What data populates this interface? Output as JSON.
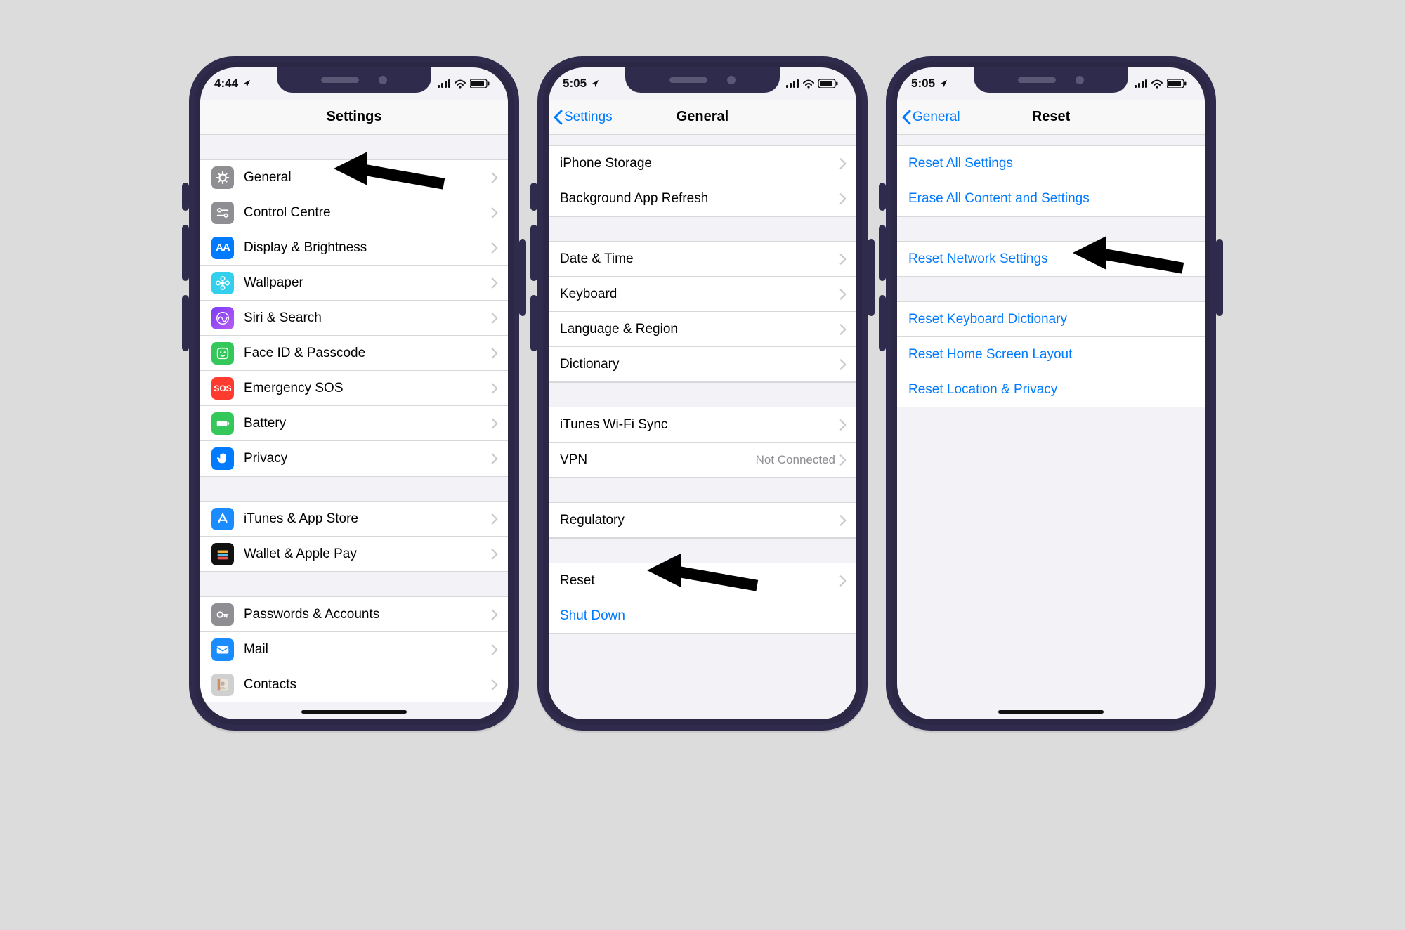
{
  "phones": [
    {
      "status": {
        "time": "4:44",
        "icons": [
          "location",
          "signal",
          "wifi",
          "battery"
        ]
      },
      "nav": {
        "title": "Settings",
        "back": null
      },
      "arrow": {
        "at": "general"
      },
      "groups": [
        {
          "items": [
            {
              "icon": "gear",
              "iconClass": "bg-grey",
              "label": "General"
            },
            {
              "icon": "sliders",
              "iconClass": "bg-grey",
              "label": "Control Centre"
            },
            {
              "icon": "aa",
              "iconClass": "bg-blue",
              "label": "Display & Brightness"
            },
            {
              "icon": "flower",
              "iconClass": "bg-teal",
              "label": "Wallpaper"
            },
            {
              "icon": "siri",
              "iconClass": "bg-purple",
              "label": "Siri & Search"
            },
            {
              "icon": "face",
              "iconClass": "bg-green",
              "label": "Face ID & Passcode"
            },
            {
              "icon": "sos",
              "iconClass": "bg-red",
              "label": "Emergency SOS"
            },
            {
              "icon": "battery",
              "iconClass": "bg-greenbatt",
              "label": "Battery"
            },
            {
              "icon": "hand",
              "iconClass": "bg-hand",
              "label": "Privacy"
            }
          ]
        },
        {
          "items": [
            {
              "icon": "appstore",
              "iconClass": "bg-store",
              "label": "iTunes & App Store"
            },
            {
              "icon": "wallet",
              "iconClass": "bg-wallet",
              "label": "Wallet & Apple Pay"
            }
          ]
        },
        {
          "items": [
            {
              "icon": "key",
              "iconClass": "bg-key",
              "label": "Passwords & Accounts"
            },
            {
              "icon": "mail",
              "iconClass": "bg-mail",
              "label": "Mail"
            },
            {
              "icon": "contacts",
              "iconClass": "bg-contacts",
              "label": "Contacts"
            }
          ]
        }
      ],
      "homeIndicator": true
    },
    {
      "status": {
        "time": "5:05",
        "icons": [
          "location",
          "signal",
          "wifi",
          "battery"
        ]
      },
      "nav": {
        "title": "General",
        "back": "Settings"
      },
      "arrow": {
        "at": "reset"
      },
      "groups": [
        {
          "gap": "tight",
          "items": [
            {
              "label": "iPhone Storage"
            },
            {
              "label": "Background App Refresh"
            }
          ]
        },
        {
          "items": [
            {
              "label": "Date & Time"
            },
            {
              "label": "Keyboard"
            },
            {
              "label": "Language & Region"
            },
            {
              "label": "Dictionary"
            }
          ]
        },
        {
          "items": [
            {
              "label": "iTunes Wi-Fi Sync"
            },
            {
              "label": "VPN",
              "detail": "Not Connected"
            }
          ]
        },
        {
          "items": [
            {
              "label": "Regulatory"
            }
          ]
        },
        {
          "items": [
            {
              "label": "Reset"
            },
            {
              "label": "Shut Down",
              "link": true,
              "noChevron": true
            }
          ]
        }
      ],
      "homeIndicator": false
    },
    {
      "status": {
        "time": "5:05",
        "icons": [
          "location",
          "signal",
          "wifi",
          "battery"
        ]
      },
      "nav": {
        "title": "Reset",
        "back": "General"
      },
      "arrow": {
        "at": "reset-network"
      },
      "groups": [
        {
          "gap": "tight",
          "items": [
            {
              "label": "Reset All Settings",
              "link": true,
              "noChevron": true
            },
            {
              "label": "Erase All Content and Settings",
              "link": true,
              "noChevron": true
            }
          ]
        },
        {
          "items": [
            {
              "label": "Reset Network Settings",
              "link": true,
              "noChevron": true
            }
          ]
        },
        {
          "items": [
            {
              "label": "Reset Keyboard Dictionary",
              "link": true,
              "noChevron": true
            },
            {
              "label": "Reset Home Screen Layout",
              "link": true,
              "noChevron": true
            },
            {
              "label": "Reset Location & Privacy",
              "link": true,
              "noChevron": true
            }
          ]
        }
      ],
      "homeIndicator": true
    }
  ]
}
